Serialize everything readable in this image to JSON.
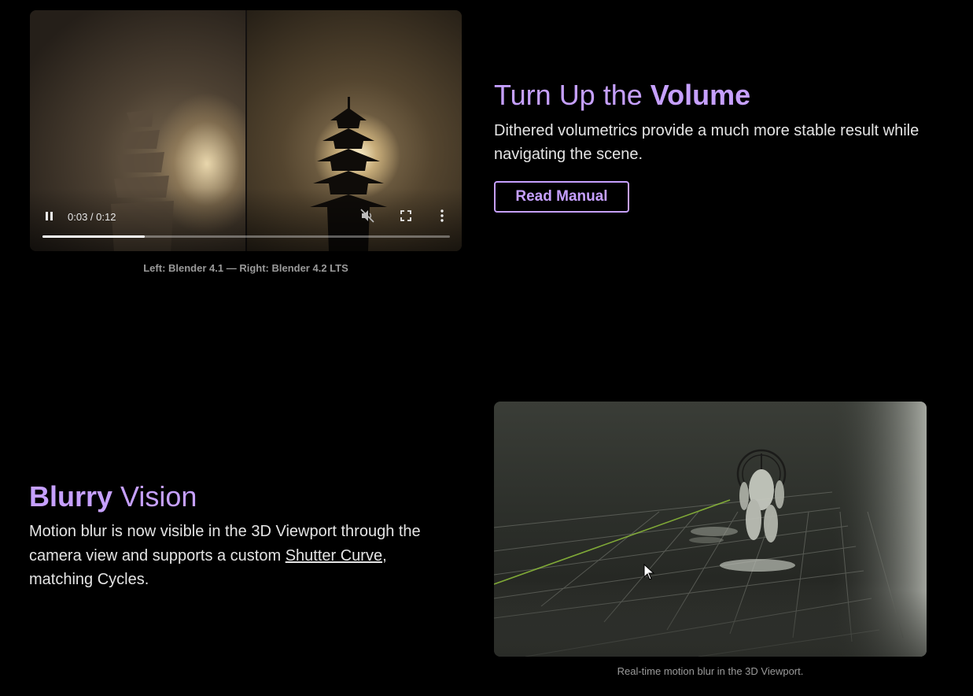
{
  "section_volume": {
    "heading_light": "Turn Up the ",
    "heading_bold": "Volume",
    "description": "Dithered volumetrics provide a much more stable result while navigating the scene.",
    "button_label": "Read Manual",
    "video": {
      "time_display": "0:03 / 0:12",
      "progress": 0.25,
      "controls": [
        "pause-icon",
        "mute-icon",
        "fullscreen-icon",
        "more-options-icon"
      ]
    },
    "caption": "Left: Blender 4.1 — Right: Blender 4.2 LTS"
  },
  "section_motion_blur": {
    "heading_bold": "Blurry",
    "heading_light": " Vision",
    "description_before_link": "Motion blur is now visible in the 3D Viewport through the camera view and supports a custom ",
    "link_text": "Shutter Curve",
    "description_after_link": ", matching Cycles.",
    "caption": "Real-time motion blur in the 3D Viewport."
  },
  "colors": {
    "accent": "#c6a0ff",
    "background": "#000000",
    "caption": "#9a9a9a"
  }
}
